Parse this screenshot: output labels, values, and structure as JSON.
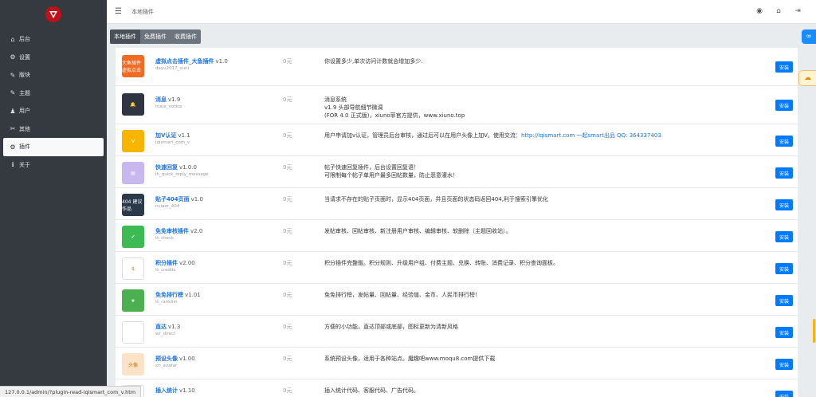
{
  "topbar": {
    "breadcrumb": "本地插件"
  },
  "sidebar": {
    "items": [
      {
        "label": "后台",
        "icon": "⌂"
      },
      {
        "label": "设置",
        "icon": "⚙"
      },
      {
        "label": "版块",
        "icon": "✎"
      },
      {
        "label": "主题",
        "icon": "✎"
      },
      {
        "label": "用户",
        "icon": "♟"
      },
      {
        "label": "其他",
        "icon": "✂"
      },
      {
        "label": "插件",
        "icon": "⚙"
      },
      {
        "label": "关于",
        "icon": "ℹ"
      }
    ],
    "active_index": 6
  },
  "tabs": [
    "本地插件",
    "免费插件",
    "收费插件"
  ],
  "install_label": "安装",
  "plugins": [
    {
      "name": "虚拟点击插件_大鱼插件",
      "version": "v1.0",
      "id": "dayu2017_xuni",
      "price": "0元",
      "desc": [
        "你设置多少,单次访问计数就会增加多少."
      ],
      "thumb_color": "#f26b22",
      "thumb_text": "大鱼插件 虚拟点击"
    },
    {
      "name": "消息",
      "version": "v1.9",
      "id": "huux_notice",
      "price": "0元",
      "desc": [
        "消息系统",
        "v1.9 头部导航细节微调",
        "(FOR 4.0 正式版)，xiuno菲官方提供，www.xiuno.top"
      ],
      "thumb_color": "#2f3542",
      "thumb_text": "🔔"
    },
    {
      "name": "加V认证",
      "version": "v1.1",
      "id": "iqismart_com_v",
      "price": "0元",
      "desc": [
        "用户申请加v认证，管理员后台审核，通过后可以在用户头像上加V。使用交流："
      ],
      "link": "http://iqismart.com 一起smart出品 QQ: 364337403",
      "thumb_color": "#f7b500",
      "thumb_text": "V"
    },
    {
      "name": "快速回复",
      "version": "v1.0.0",
      "id": "lh_quick_reply_message",
      "price": "0元",
      "desc": [
        "帖子快速回复插件，后台设置回复语！",
        "可限制每个帖子单用户最多回帖数量，防止恶意灌水！"
      ],
      "thumb_color": "#c9b8f0",
      "thumb_text": "▤"
    },
    {
      "name": "贴子404页面",
      "version": "v1.0",
      "id": "nciaer_404",
      "price": "0元",
      "desc": [
        "当请求不存在的贴子页面时，显示404页面，并且页面的状态码返回404,利于搜索引擎优化"
      ],
      "thumb_color": "#2a3a4a",
      "thumb_text": "404 建议作品"
    },
    {
      "name": "免免审核插件",
      "version": "v2.0",
      "id": "tt_check",
      "price": "0元",
      "desc": [
        "发帖审核、回帖审核、新注册用户审核、编辑审核、软删除（主题回收站）。"
      ],
      "thumb_color": "#3cba54",
      "thumb_text": "✔"
    },
    {
      "name": "积分插件",
      "version": "v2.00",
      "id": "tt_credits",
      "price": "0元",
      "desc": [
        "积分插件完整版。积分规则、升级用户组、付费主题、兑换、转账、消费记录、积分查询面板。"
      ],
      "thumb_color": "#ffffff",
      "thumb_text": "$"
    },
    {
      "name": "免免排行榜",
      "version": "v1.01",
      "id": "tt_ranklist",
      "price": "0元",
      "desc": [
        "免免排行榜，发帖量、回帖量、经验值、金币、人民币排行榜！"
      ],
      "thumb_color": "#4caf50",
      "thumb_text": "★"
    },
    {
      "name": "直达",
      "version": "v1.3",
      "id": "wr_direct",
      "price": "0元",
      "desc": [
        "方便的小功能，直达顶部或底部，图标更新为清新风格"
      ],
      "thumb_color": "#ffffff",
      "thumb_text": ""
    },
    {
      "name": "预设头像",
      "version": "v1.00",
      "id": "xn_avatar",
      "price": "0元",
      "desc": [
        "系统预设头像，适用于各种站点。魔趣吧www.moqu8.com提供下载"
      ],
      "thumb_color": "#fbe3c8",
      "thumb_text": "头像"
    },
    {
      "name": "插入统计",
      "version": "v1.10",
      "id": "",
      "price": "0元",
      "desc": [
        "插入统计代码、客服代码、广告代码。"
      ],
      "thumb_color": "#ffffff",
      "thumb_text": ""
    }
  ],
  "statusbar": "127.0.0.1/admin/?plugin-read-iqismart_com_v.htm"
}
